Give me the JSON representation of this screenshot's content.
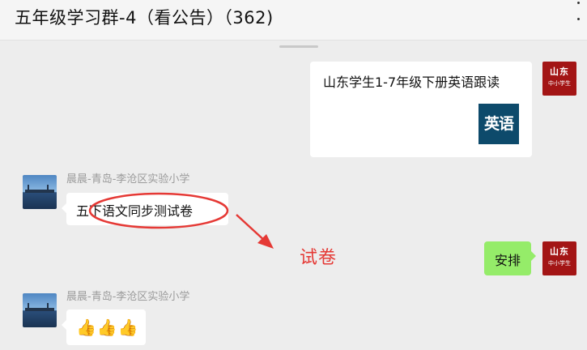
{
  "header": {
    "title": "五年级学习群-4（看公告）（362)"
  },
  "avatars": {
    "school": {
      "line1": "山东",
      "line2": "中小学生"
    }
  },
  "messages": [
    {
      "direction": "outgoing",
      "type": "link-card",
      "title": "山东学生1-7年级下册英语跟读",
      "thumb_text": "英语",
      "thumb_color": "#0d4a6b"
    },
    {
      "direction": "incoming",
      "sender": "晨晨-青岛-李沧区实验小学",
      "text": "五下语文同步测试卷"
    },
    {
      "direction": "outgoing",
      "text": "安排",
      "bubble_color": "#95ec69"
    },
    {
      "direction": "incoming",
      "sender": "晨晨-青岛-李沧区实验小学",
      "text": "👍👍👍"
    }
  ],
  "annotation": {
    "label": "试卷",
    "color": "#e53935"
  }
}
